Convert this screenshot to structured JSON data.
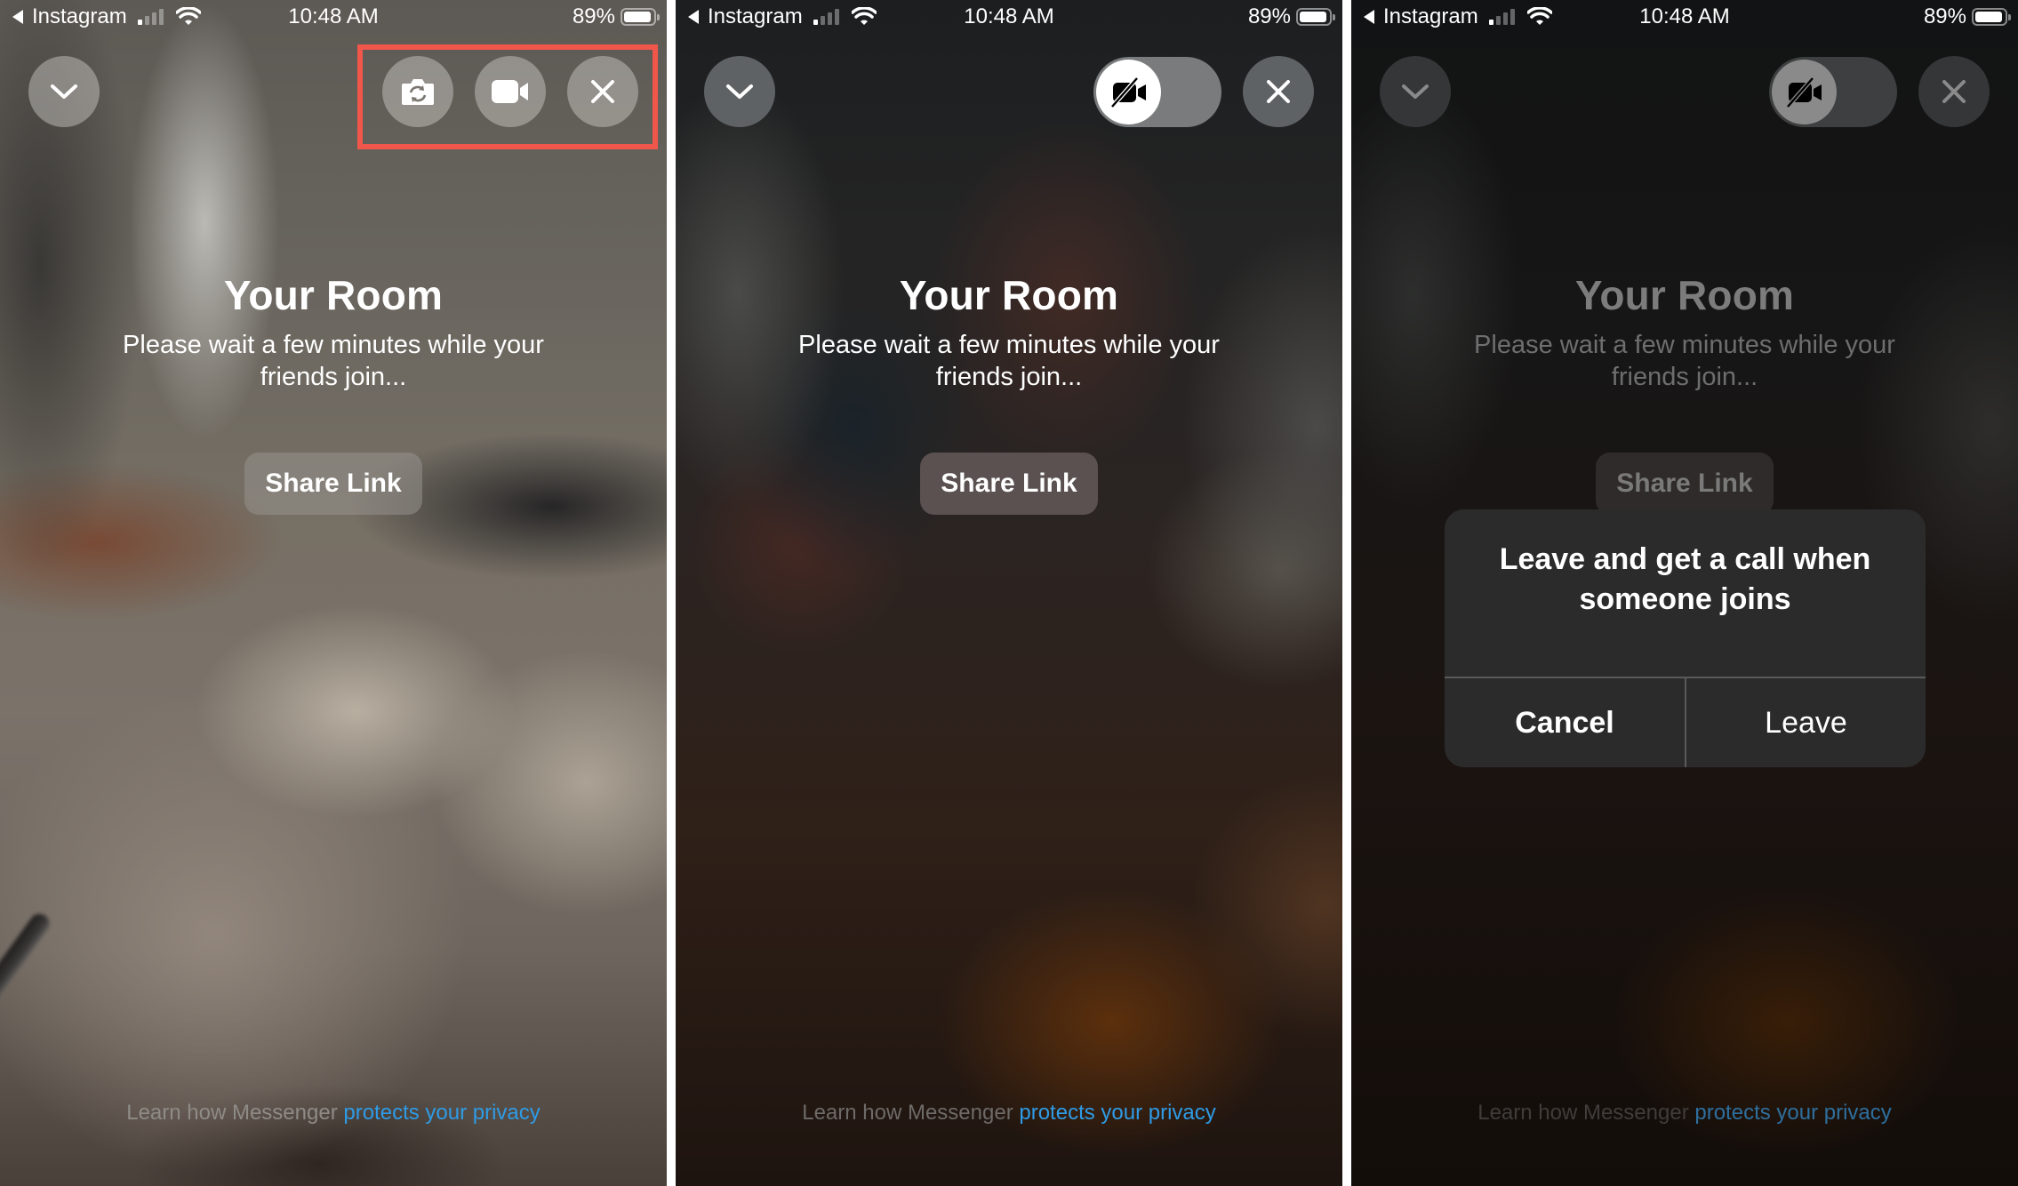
{
  "status_bar": {
    "back_app": "Instagram",
    "time": "10:48 AM",
    "battery": "89%",
    "signal_bars_filled": 1,
    "signal_bars_total": 4
  },
  "room": {
    "title": "Your Room",
    "subtitle": "Please wait a few minutes while your friends join...",
    "share_label": "Share Link"
  },
  "footer": {
    "prefix": "Learn how Messenger ",
    "link": "protects your privacy"
  },
  "icons": {
    "minimize": "chevron-down-icon",
    "flip_camera": "flip-camera-icon",
    "camera_on": "video-camera-icon",
    "camera_off": "video-camera-off-icon",
    "close": "close-icon"
  },
  "panels": [
    {
      "state": "camera-on",
      "controls": [
        "chevron-down",
        "flip-camera",
        "video-camera",
        "close"
      ],
      "highlighted": true
    },
    {
      "state": "camera-off",
      "controls": [
        "chevron-down",
        "camera-toggle",
        "close"
      ],
      "camera_toggle": "off"
    },
    {
      "state": "leave-dialog",
      "controls": [
        "chevron-down",
        "camera-toggle",
        "close"
      ],
      "camera_toggle": "off"
    }
  ],
  "dialog": {
    "message": "Leave and get a call when someone joins",
    "cancel_label": "Cancel",
    "leave_label": "Leave"
  },
  "colors": {
    "highlight_box": "#f0564a",
    "link": "#2f9be5",
    "dialog_bg": "#2c2b2b"
  }
}
